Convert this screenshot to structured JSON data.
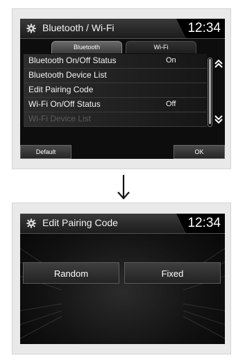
{
  "screen1": {
    "title": "Bluetooth / Wi-Fi",
    "clock": "12:34",
    "tabs": [
      {
        "label": "Bluetooth",
        "active": true
      },
      {
        "label": "Wi-Fi",
        "active": false
      }
    ],
    "rows": [
      {
        "label": "Bluetooth On/Off Status",
        "value": "On"
      },
      {
        "label": "Bluetooth Device List",
        "value": ""
      },
      {
        "label": "Edit Pairing Code",
        "value": ""
      },
      {
        "label": "Wi-Fi On/Off Status",
        "value": "Off"
      },
      {
        "label": "Wi-Fi Device List",
        "value": ""
      }
    ],
    "default_label": "Default",
    "ok_label": "OK",
    "icons": {
      "settings": "gear-icon",
      "scroll_up": "double-chevron-up-icon",
      "scroll_down": "double-chevron-down-icon"
    }
  },
  "screen2": {
    "title": "Edit Pairing Code",
    "clock": "12:34",
    "random_label": "Random",
    "fixed_label": "Fixed"
  },
  "colors": {
    "screen_bg": "#0d0d0d",
    "panel_bg": "#e9e9e9",
    "text": "#f4f4f4",
    "disabled_text": "#5a5a5a"
  }
}
